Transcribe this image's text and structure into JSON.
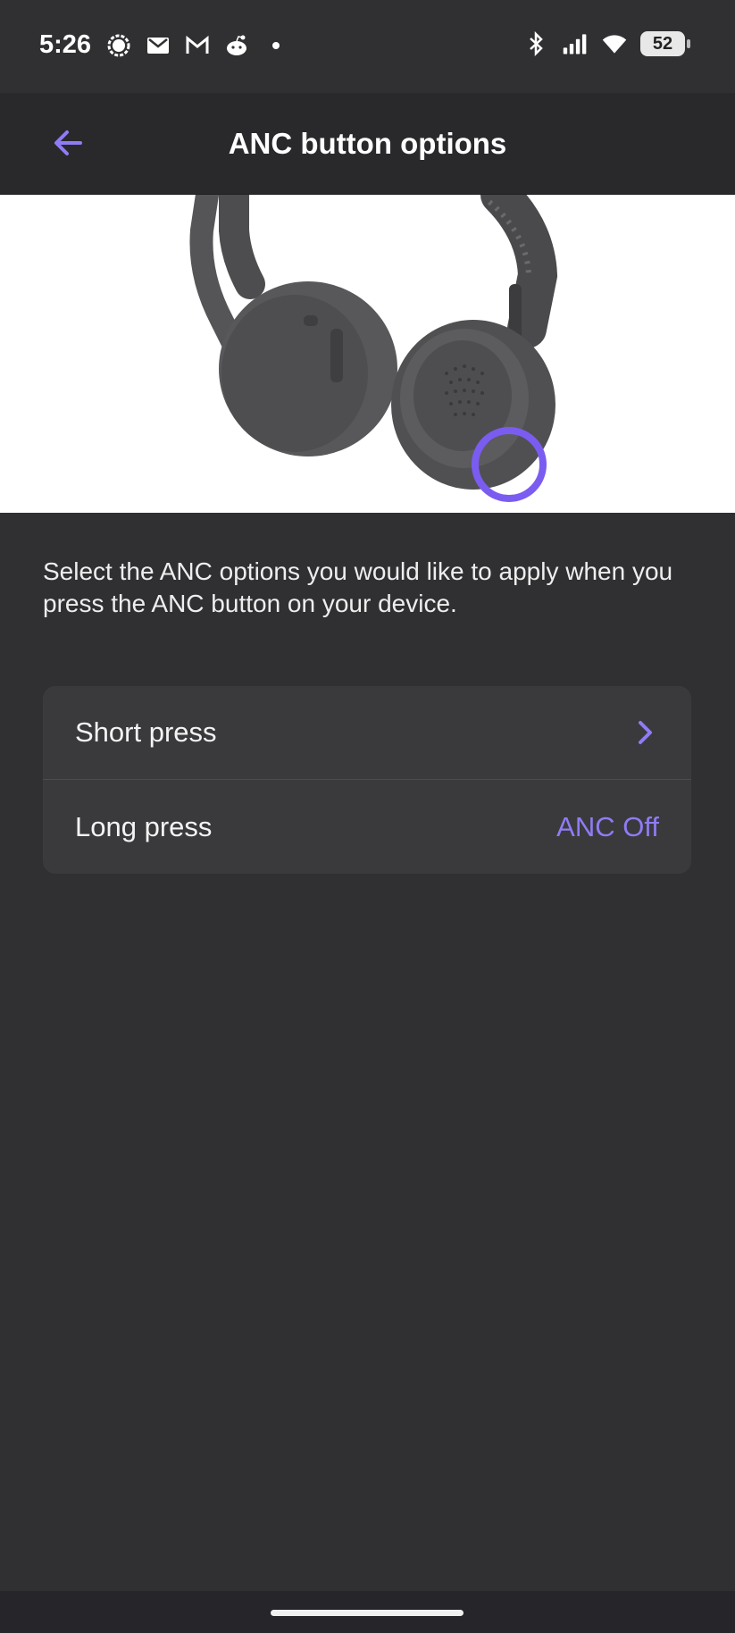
{
  "status_bar": {
    "time": "5:26",
    "left_icons": [
      "signal-app-icon",
      "gmail-icon",
      "gmail-outline-icon",
      "reddit-icon",
      "dot-icon"
    ],
    "right_icons": [
      "bluetooth-icon",
      "cell-signal-icon",
      "wifi-icon"
    ],
    "battery": "52"
  },
  "app_bar": {
    "title": "ANC button options",
    "back_icon": "arrow-left-icon"
  },
  "hero": {
    "image": "headset-illustration",
    "highlight_color": "#7b5cf0"
  },
  "description": "Select the ANC options you would like to apply when you press the ANC button on your device.",
  "options": [
    {
      "label": "Short press",
      "value": "",
      "icon": "chevron-right-icon"
    },
    {
      "label": "Long press",
      "value": "ANC Off"
    }
  ],
  "colors": {
    "background": "#303033",
    "accent": "#8f7cf4",
    "card": "#3a3a3d"
  }
}
